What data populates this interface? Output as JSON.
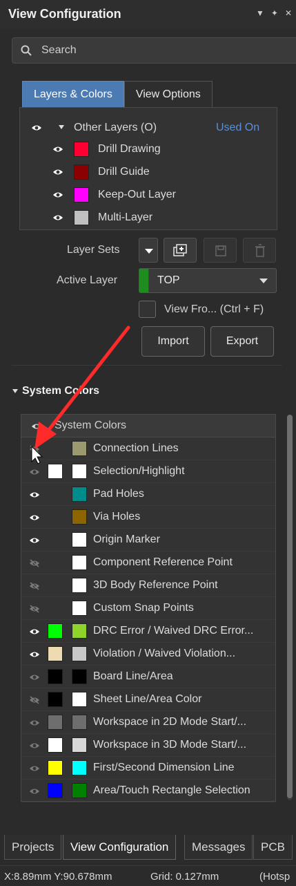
{
  "panel": {
    "title": "View Configuration"
  },
  "search": {
    "placeholder": "Search"
  },
  "tabs": [
    {
      "label": "Layers & Colors",
      "active": true
    },
    {
      "label": "View Options",
      "active": false
    }
  ],
  "layers": {
    "group": {
      "label": "Other Layers (O)",
      "status": "Used On"
    },
    "items": [
      {
        "label": "Drill Drawing",
        "color": "#ff0033"
      },
      {
        "label": "Drill Guide",
        "color": "#8b0000"
      },
      {
        "label": "Keep-Out Layer",
        "color": "#ff00ff"
      },
      {
        "label": "Multi-Layer",
        "color": "#c0c0c0"
      }
    ]
  },
  "controls": {
    "layer_sets_label": "Layer Sets",
    "active_layer_label": "Active Layer",
    "active_layer_value": "TOP",
    "active_layer_color": "#1e8c1e",
    "view_from_label": "View Fro... (Ctrl + F)",
    "import_label": "Import",
    "export_label": "Export"
  },
  "system_colors": {
    "section_title": "System Colors",
    "header_label": "System Colors",
    "rows": [
      {
        "label": "Connection Lines",
        "visible": "hidden",
        "c1": null,
        "c2": "#9a9a6e"
      },
      {
        "label": "Selection/Highlight",
        "visible": "dim",
        "c1": "#ffffff",
        "c2": "#ffffff"
      },
      {
        "label": "Pad Holes",
        "visible": "on",
        "c1": null,
        "c2": "#008c8c"
      },
      {
        "label": "Via Holes",
        "visible": "on",
        "c1": null,
        "c2": "#8c6400"
      },
      {
        "label": "Origin Marker",
        "visible": "on",
        "c1": null,
        "c2": "#ffffff"
      },
      {
        "label": "Component Reference Point",
        "visible": "off",
        "c1": null,
        "c2": "#ffffff"
      },
      {
        "label": "3D Body Reference Point",
        "visible": "off",
        "c1": null,
        "c2": "#ffffff"
      },
      {
        "label": "Custom Snap Points",
        "visible": "off",
        "c1": null,
        "c2": "#ffffff"
      },
      {
        "label": "DRC Error / Waived DRC Error...",
        "visible": "on",
        "c1": "#00ff00",
        "c2": "#8fd42a"
      },
      {
        "label": "Violation / Waived Violation...",
        "visible": "on",
        "c1": "#eedcb0",
        "c2": "#c8c8c8"
      },
      {
        "label": "Board Line/Area",
        "visible": "dim",
        "c1": "#000000",
        "c2": "#000000"
      },
      {
        "label": "Sheet Line/Area Color",
        "visible": "off",
        "c1": "#000000",
        "c2": "#ffffff"
      },
      {
        "label": "Workspace in 2D Mode Start/...",
        "visible": "dim",
        "c1": "#6e6e6e",
        "c2": "#6e6e6e"
      },
      {
        "label": "Workspace in 3D Mode Start/...",
        "visible": "dim",
        "c1": "#ffffff",
        "c2": "#d8d8d8"
      },
      {
        "label": "First/Second Dimension Line",
        "visible": "dim",
        "c1": "#ffff00",
        "c2": "#00ffff"
      },
      {
        "label": "Area/Touch Rectangle Selection",
        "visible": "dim",
        "c1": "#0000ff",
        "c2": "#008000"
      }
    ]
  },
  "bottom_tabs": [
    {
      "label": "Projects",
      "active": false
    },
    {
      "label": "View Configuration",
      "active": true
    },
    {
      "label": "Messages",
      "active": false
    },
    {
      "label": "PCB",
      "active": false
    }
  ],
  "status_bar": {
    "coords": "X:8.89mm Y:90.678mm",
    "grid": "Grid: 0.127mm",
    "hotspot": "(Hotsp"
  },
  "colors": {
    "accent": "#4c7bb3",
    "arrow": "#ff2a2a"
  }
}
